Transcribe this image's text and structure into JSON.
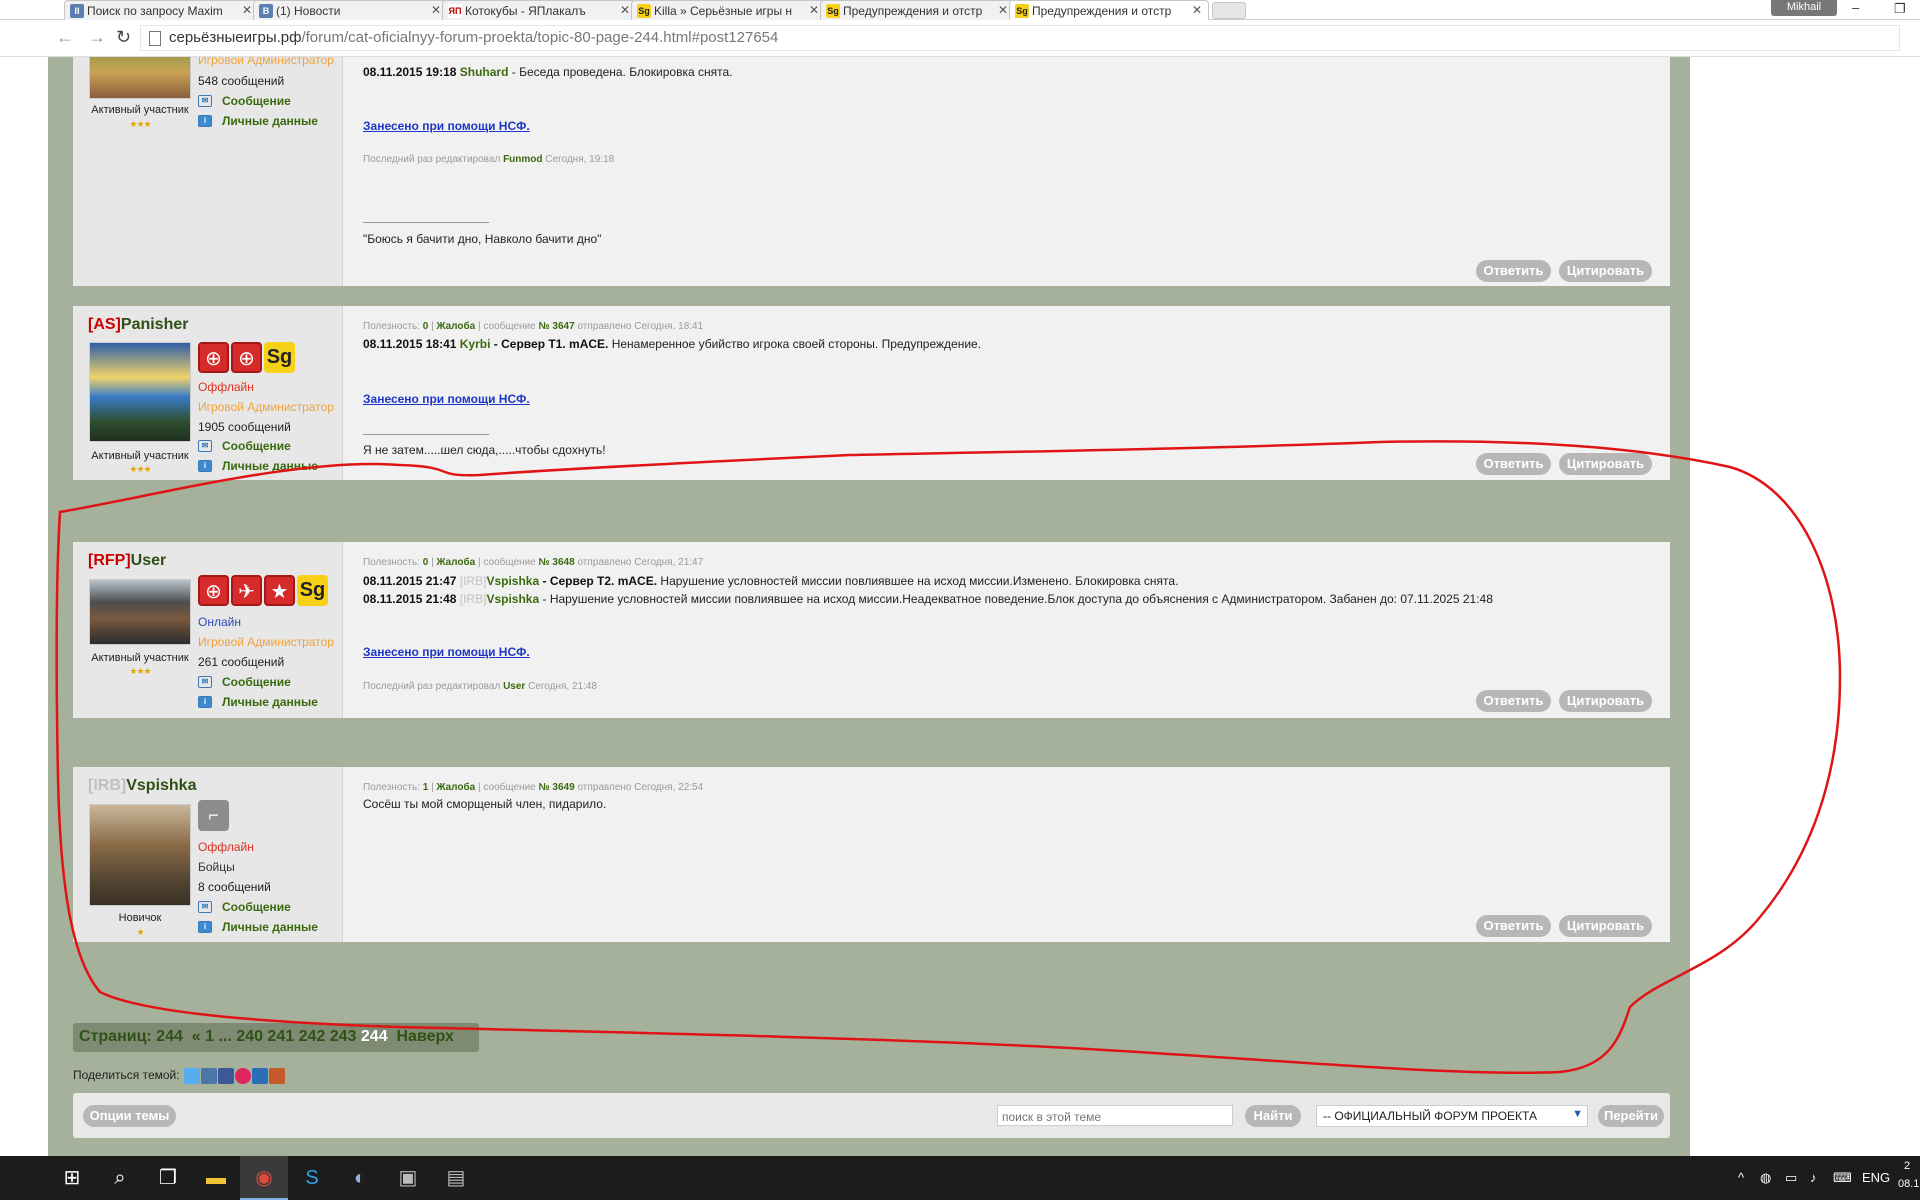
{
  "browser": {
    "tabs": [
      {
        "title": "Поиск по запросу Maxim",
        "icon": "pause-icon",
        "icon_color": "#5b7fb1"
      },
      {
        "title": "(1) Новости",
        "icon": "vk-icon",
        "icon_color": "#5b7fb1"
      },
      {
        "title": "Котокубы - ЯПлакалъ",
        "icon": "yap-icon",
        "icon_color": "#c00000"
      },
      {
        "title": "Killa » Серьёзные игры н",
        "icon": "sg-icon",
        "icon_color": "#f7d117"
      },
      {
        "title": "Предупреждения и отстр",
        "icon": "sg-icon",
        "icon_color": "#f7d117"
      },
      {
        "title": "Предупреждения и отстр",
        "icon": "sg-icon",
        "icon_color": "#f7d117"
      }
    ],
    "profile_name": "Mikhail",
    "url_host": "серьёзныеигры.рф",
    "url_path": "/forum/cat-oficialnyy-forum-proekta/topic-80-page-244.html#post127654"
  },
  "posts": [
    {
      "top_rows": {
        "group": "Игровой Администратор",
        "post_count": "548 сообщений",
        "pm_label": "Сообщение",
        "profile_label": "Личные данные",
        "rank": "Активный участник",
        "stars": "★★★"
      },
      "line_date": "08.11.2015 19:18",
      "line_admin": "Shuhard",
      "line_text": "- Беседа проведена. Блокировка снята.",
      "nsf": "Занесено при помощи НСФ.",
      "edited_prefix": "Последний раз редактировал",
      "edited_by": "Funmod",
      "edited_when": "Сегодня, 19:18",
      "signature": "\"Боюсь я бачити дно, Навколо бачити дно\"",
      "reply": "Ответить",
      "quote": "Цитировать"
    },
    {
      "clan": "[AS]",
      "author": "Panisher",
      "status": "Оффлайн",
      "group": "Игровой Администратор",
      "post_count": "1905 сообщений",
      "pm_label": "Сообщение",
      "profile_label": "Личные данные",
      "rank": "Активный участник",
      "stars": "★★★",
      "meta_usefulness": "Полезность:",
      "meta_score": "0",
      "meta_complaint": "Жалоба",
      "meta_msg": "сообщение",
      "meta_num": "№ 3647",
      "meta_sent": "отправлено Сегодня, 18:41",
      "line_date": "08.11.2015 18:41",
      "line_admin": "Kyrbi",
      "line_server": "- Сервер T1. mACE.",
      "line_text": "Ненамеренное убийство игрока своей стороны. Предупреждение.",
      "nsf": "Занесено при помощи НСФ.",
      "signature": "Я не затем.....шел сюда,.....чтобы сдохнуть!",
      "reply": "Ответить",
      "quote": "Цитировать"
    },
    {
      "clan": "[RFP]",
      "author": "User",
      "status": "Онлайн",
      "group": "Игровой Администратор",
      "post_count": "261 сообщений",
      "pm_label": "Сообщение",
      "profile_label": "Личные данные",
      "rank": "Активный участник",
      "stars": "★★★",
      "meta_usefulness": "Полезность:",
      "meta_score": "0",
      "meta_complaint": "Жалоба",
      "meta_msg": "сообщение",
      "meta_num": "№ 3648",
      "meta_sent": "отправлено Сегодня, 21:47",
      "line1_date": "08.11.2015 21:47",
      "line1_clan": "[IRB]",
      "line1_name": "Vspishka",
      "line1_server": "- Сервер T2. mACE.",
      "line1_text": "Нарушение условностей миссии повлиявшее на исход миссии.Изменено. Блокировка снята.",
      "line2_date": "08.11.2015 21:48",
      "line2_clan": "[IRB]",
      "line2_name": "Vspishka",
      "line2_text": "- Нарушение условностей миссии повлиявшее на исход миссии.Неадекватное поведение.Блок доступа до объяснения с Администратором. Забанен до: 07.11.2025 21:48",
      "nsf": "Занесено при помощи НСФ.",
      "edited_prefix": "Последний раз редактировал",
      "edited_by": "User",
      "edited_when": "Сегодня, 21:48",
      "reply": "Ответить",
      "quote": "Цитировать"
    },
    {
      "clan": "[IRB]",
      "author": "Vspishka",
      "status": "Оффлайн",
      "group": "Бойцы",
      "post_count": "8 сообщений",
      "pm_label": "Сообщение",
      "profile_label": "Личные данные",
      "rank": "Новичок",
      "stars": "★",
      "meta_usefulness": "Полезность:",
      "meta_score": "1",
      "meta_complaint": "Жалоба",
      "meta_msg": "сообщение",
      "meta_num": "№ 3649",
      "meta_sent": "отправлено Сегодня, 22:54",
      "body": "Сосёш ты мой сморщеный член, пидарило.",
      "reply": "Ответить",
      "quote": "Цитировать"
    }
  ],
  "pager": {
    "label": "Страниц: 244",
    "first": "« 1",
    "dots": "...",
    "pages": [
      "240",
      "241",
      "242",
      "243"
    ],
    "current": "244",
    "top": "Наверх"
  },
  "share_label": "Поделиться темой:",
  "bottom": {
    "options": "Опции темы",
    "search_placeholder": "поиск в этой теме",
    "find": "Найти",
    "forum_select": "-- ОФИЦИАЛЬНЫЙ ФОРУМ ПРОЕКТА",
    "go": "Перейти"
  },
  "taskbar": {
    "lang": "ENG",
    "clock_time": "2",
    "clock_date": "08.1"
  }
}
